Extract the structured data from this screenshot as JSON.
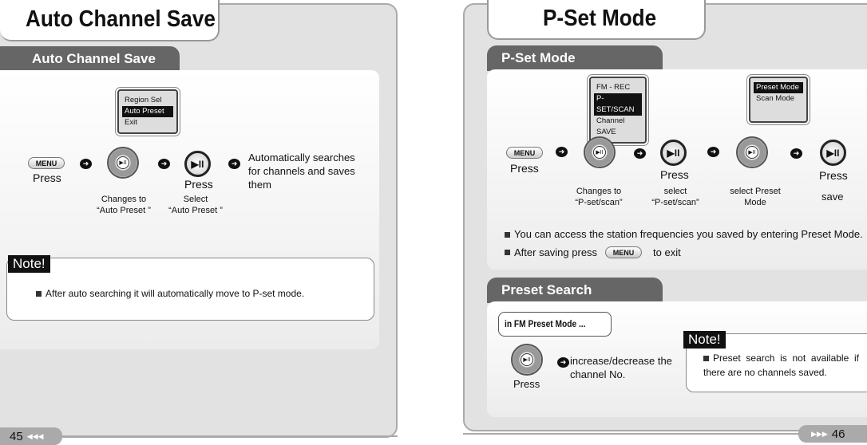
{
  "left": {
    "title": "Auto Channel Save",
    "section": "Auto Channel Save",
    "menu_label": "MENU",
    "lcd": [
      "Region Sel",
      "Auto Preset",
      "Exit"
    ],
    "lcd_selected": 1,
    "play_glyph": "▶II",
    "step1": "Press",
    "step2": [
      "Changes to",
      "“Auto Preset ”"
    ],
    "step3_press": "Press",
    "step3": [
      "Select",
      "“Auto Preset ”"
    ],
    "result": [
      "Automatically searches",
      "for channels and saves",
      "them"
    ],
    "note_label": "Note!",
    "note_text": "After auto searching it will automatically move to P-set mode.",
    "page_number": "45",
    "page_arrows": "◀◀◀"
  },
  "right": {
    "title": "P-Set Mode",
    "section": "P-Set Mode",
    "menu_label": "MENU",
    "lcd1": [
      "FM - REC",
      "P-SET/SCAN",
      "Channel SAVE"
    ],
    "lcd2": [
      "Preset Mode",
      "Scan Mode"
    ],
    "play_glyph": "▶II",
    "step1": "Press",
    "step2": [
      "Changes to",
      "“P-set/scan”"
    ],
    "step3_press": "Press",
    "step3": [
      "select",
      "“P-set/scan”"
    ],
    "step4": [
      "select Preset",
      "Mode"
    ],
    "step5_press": "Press",
    "step5": "save",
    "bullet1": "You can access the station frequencies you saved by entering Preset Mode.",
    "bullet2_pre": "After saving press",
    "bullet2_post": "to exit",
    "section2": "Preset Search",
    "callout": "in FM Preset Mode ...",
    "search_press": "Press",
    "search_result": [
      "increase/decrease the",
      "channel No."
    ],
    "note_label": "Note!",
    "note_text": "Preset search is not available if there are no channels saved.",
    "page_number": "46",
    "page_arrows": "▶▶▶"
  }
}
